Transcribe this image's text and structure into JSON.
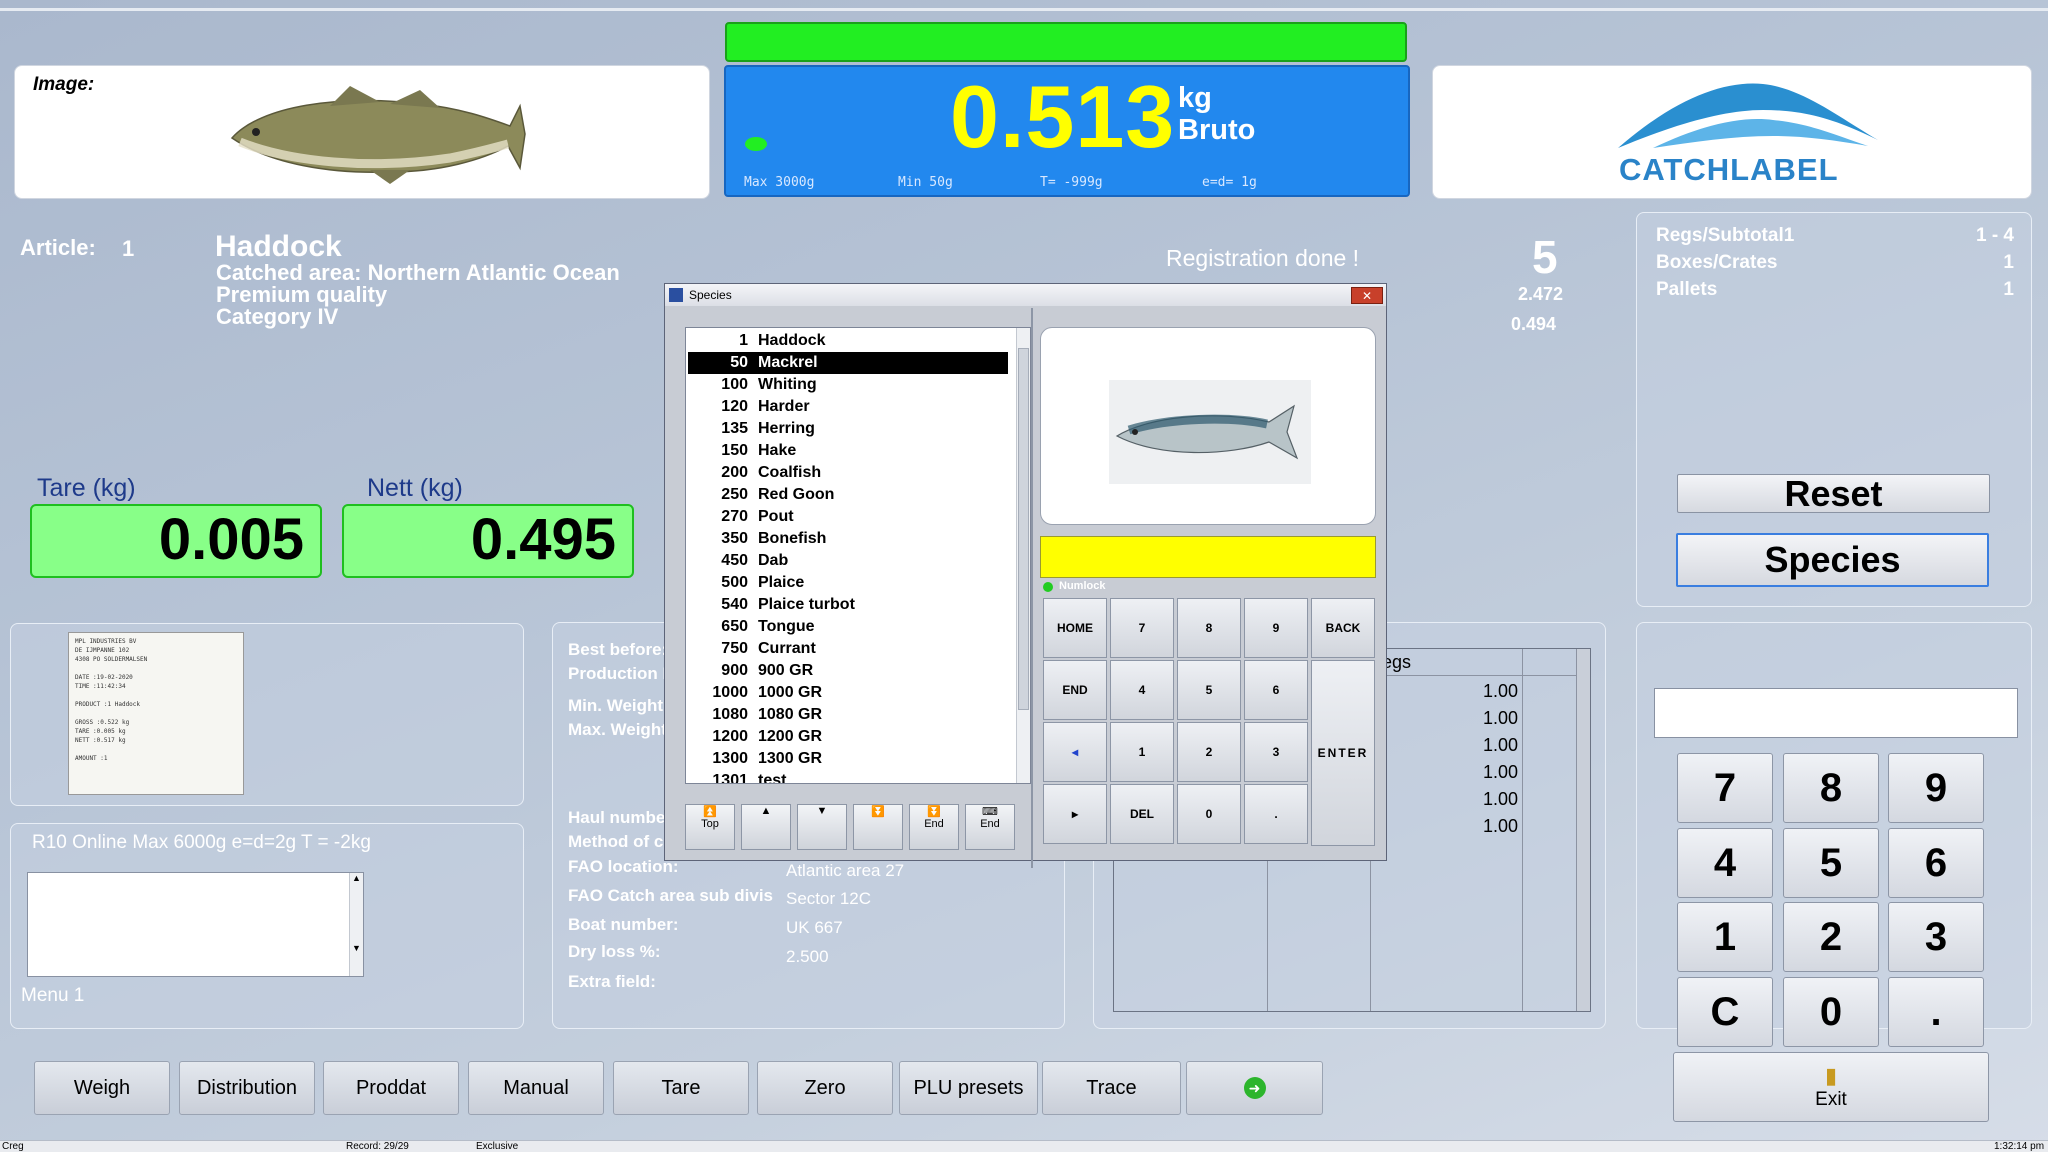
{
  "image_panel": {
    "label": "Image:"
  },
  "scale": {
    "weight": "0.513",
    "unit": "kg",
    "mode": "Bruto",
    "max": "Max 3000g",
    "min": "Min  50g",
    "tare": "T= -999g",
    "e": "e=d= 1g"
  },
  "logo": {
    "text": "CATCHLABEL"
  },
  "article": {
    "label": "Article:",
    "number": "1",
    "name": "Haddock",
    "lines": [
      "Catched area: Northern  Atlantic Ocean",
      "Premium quality",
      "Category IV"
    ]
  },
  "registration": {
    "message": "Registration done !",
    "count": "5",
    "value1": "2.472",
    "value2": "0.494"
  },
  "regs_panel": {
    "rows": [
      {
        "label": "Regs/Subtotal1",
        "value": "1 - 4"
      },
      {
        "label": "Boxes/Crates",
        "value": "1"
      },
      {
        "label": "Pallets",
        "value": "1"
      }
    ],
    "reset_label": "Reset",
    "species_label": "Species"
  },
  "tare": {
    "label": "Tare (kg)",
    "value": "0.005"
  },
  "nett": {
    "label": "Nett (kg)",
    "value": "0.495"
  },
  "info": {
    "best_before": "Best before:",
    "production": "Production D",
    "min_weight": "Min. Weight",
    "max_weight": "Max. Weight",
    "haul": "Haul numbe",
    "method": "Method of c",
    "fao_location": "FAO location:",
    "fao_location_val": "Atlantic area 27",
    "fao_sub": "FAO Catch area sub divis",
    "fao_sub_val": "Sector 12C",
    "boat": "Boat number:",
    "boat_val": "UK 667",
    "dry": "Dry loss %:",
    "dry_val": "2.500",
    "extra": "Extra field:"
  },
  "label_doc": {
    "lines": [
      "MPL INDUSTRIES BV",
      "DE IJMPANNE 102",
      "4308 PO SOLDERMALSEN",
      "DATE    :19-02-2020",
      "TIME    :11:42:34",
      "PRODUCT  :1  Haddock",
      "GROSS   :0.522 kg",
      "TARE    :0.005 kg",
      "NETT    :0.517 kg",
      "AMOUNT  :1"
    ]
  },
  "online": {
    "text": "R10 Online Max 6000g e=d=2g T = -2kg",
    "menu": "Menu 1"
  },
  "grid": {
    "header": "egs",
    "values": [
      "1.00",
      "1.00",
      "1.00",
      "1.00",
      "1.00",
      "1.00"
    ]
  },
  "keypad": {
    "keys": [
      "7",
      "8",
      "9",
      "4",
      "5",
      "6",
      "1",
      "2",
      "3",
      "C",
      "0",
      "."
    ],
    "exit_label": "Exit"
  },
  "bottom_buttons": [
    "Weigh",
    "Distribution",
    "Proddat",
    "Manual",
    "Tare",
    "Zero",
    "PLU presets",
    "Trace"
  ],
  "dialog": {
    "title": "Species",
    "list": [
      {
        "num": "1",
        "name": "Haddock"
      },
      {
        "num": "50",
        "name": "Mackrel"
      },
      {
        "num": "100",
        "name": "Whiting"
      },
      {
        "num": "120",
        "name": "Harder"
      },
      {
        "num": "135",
        "name": "Herring"
      },
      {
        "num": "150",
        "name": "Hake"
      },
      {
        "num": "200",
        "name": "Coalfish"
      },
      {
        "num": "250",
        "name": "Red Goon"
      },
      {
        "num": "270",
        "name": "Pout"
      },
      {
        "num": "350",
        "name": "Bonefish"
      },
      {
        "num": "450",
        "name": "Dab"
      },
      {
        "num": "500",
        "name": "Plaice"
      },
      {
        "num": "540",
        "name": "Plaice turbot"
      },
      {
        "num": "650",
        "name": "Tongue"
      },
      {
        "num": "750",
        "name": "Currant"
      },
      {
        "num": "900",
        "name": "900 GR"
      },
      {
        "num": "1000",
        "name": "1000 GR"
      },
      {
        "num": "1080",
        "name": "1080 GR"
      },
      {
        "num": "1200",
        "name": "1200 GR"
      },
      {
        "num": "1300",
        "name": "1300 GR"
      },
      {
        "num": "1301",
        "name": "test"
      }
    ],
    "selected_index": 1,
    "nav": [
      "Top",
      "",
      "",
      "",
      "End",
      "End"
    ],
    "numlock": "Numlock",
    "keys": [
      "HOME",
      "7",
      "8",
      "9",
      "BACK",
      "END",
      "4",
      "5",
      "6",
      "",
      "◂",
      "1",
      "2",
      "3",
      "",
      "▸",
      "DEL",
      "0",
      ".",
      ""
    ],
    "enter_label": "ENTER"
  },
  "status_bar": {
    "left": "Creg",
    "record": "Record: 29/29",
    "mode": "Exclusive",
    "time": "1:32:14 pm"
  },
  "colors": {
    "scale_blue": "#2288ee",
    "ok_green": "#88ff88",
    "weight_yellow": "#ffff00"
  }
}
